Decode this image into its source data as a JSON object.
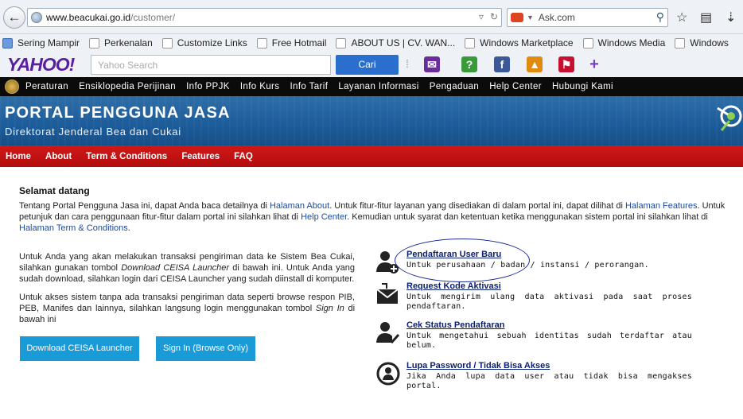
{
  "browser": {
    "url_domain": "www.beacukai.go.id",
    "url_path": "/customer/",
    "search_engine": "Ask.com"
  },
  "bookmarks": [
    {
      "label": "Sering Mampir"
    },
    {
      "label": "Perkenalan"
    },
    {
      "label": "Customize Links"
    },
    {
      "label": "Free Hotmail"
    },
    {
      "label": "ABOUT US | CV. WAN..."
    },
    {
      "label": "Windows Marketplace"
    },
    {
      "label": "Windows Media"
    },
    {
      "label": "Windows"
    }
  ],
  "yahoo_toolbar": {
    "logo": "YAHOO!",
    "search_placeholder": "Yahoo Search",
    "search_button": "Cari"
  },
  "top_menu": [
    "Peraturan",
    "Ensiklopedia Perijinan",
    "Info PPJK",
    "Info Kurs",
    "Info Tarif",
    "Layanan Informasi",
    "Pengaduan",
    "Help Center",
    "Hubungi Kami"
  ],
  "banner": {
    "title": "PORTAL PENGGUNA JASA",
    "subtitle": "Direktorat Jenderal Bea dan Cukai"
  },
  "main_nav": [
    "Home",
    "About",
    "Term & Conditions",
    "Features",
    "FAQ"
  ],
  "content": {
    "heading": "Selamat datang",
    "intro_1": "Tentang Portal Pengguna Jasa ini, dapat Anda baca detailnya di ",
    "intro_link_1": "Halaman About",
    "intro_2": ". Untuk fitur-fitur layanan yang disediakan di dalam portal ini, dapat dilihat di ",
    "intro_link_2": "Halaman Features",
    "intro_3": ". Untuk petunjuk dan cara penggunaan fitur-fitur dalam portal ini silahkan lihat di ",
    "intro_link_3": "Help Center",
    "intro_4": ". Kemudian untuk syarat dan ketentuan ketika menggunakan sistem portal ini silahkan lihat di ",
    "intro_link_4": "Halaman Term & Conditions",
    "intro_5": ".",
    "para_1a": "Untuk Anda yang akan melakukan transaksi pengiriman data ke Sistem Bea Cukai, silahkan gunakan tombol ",
    "para_1_em": "Download CEISA Launcher",
    "para_1b": " di bawah ini. Untuk Anda yang sudah download, silahkan login dari CEISA Launcher yang sudah diinstall di komputer.",
    "para_2a": "Untuk akses sistem tanpa ada transaksi pengiriman data seperti browse respon PIB, PEB, Manifes dan lainnya, silahkan langsung login menggunakan tombol ",
    "para_2_em": "Sign In",
    "para_2b": " di bawah ini",
    "download_button": "Download CEISA Launcher",
    "signin_button": "Sign In (Browse Only)"
  },
  "actions": [
    {
      "title": "Pendaftaran User Baru",
      "desc": "Untuk perusahaan / badan / instansi / perorangan.",
      "icon": "add-user-icon"
    },
    {
      "title": "Request Kode Aktivasi",
      "desc": "Untuk mengirim ulang data aktivasi pada saat proses pendaftaran.",
      "icon": "mail-icon"
    },
    {
      "title": "Cek Status Pendaftaran",
      "desc": "Untuk mengetahui sebuah identitas sudah terdaftar atau belum.",
      "icon": "user-check-icon"
    },
    {
      "title": "Lupa Password / Tidak Bisa Akses",
      "desc": "Jika Anda lupa data user atau tidak bisa mengakses portal.",
      "icon": "user-refresh-icon"
    }
  ]
}
